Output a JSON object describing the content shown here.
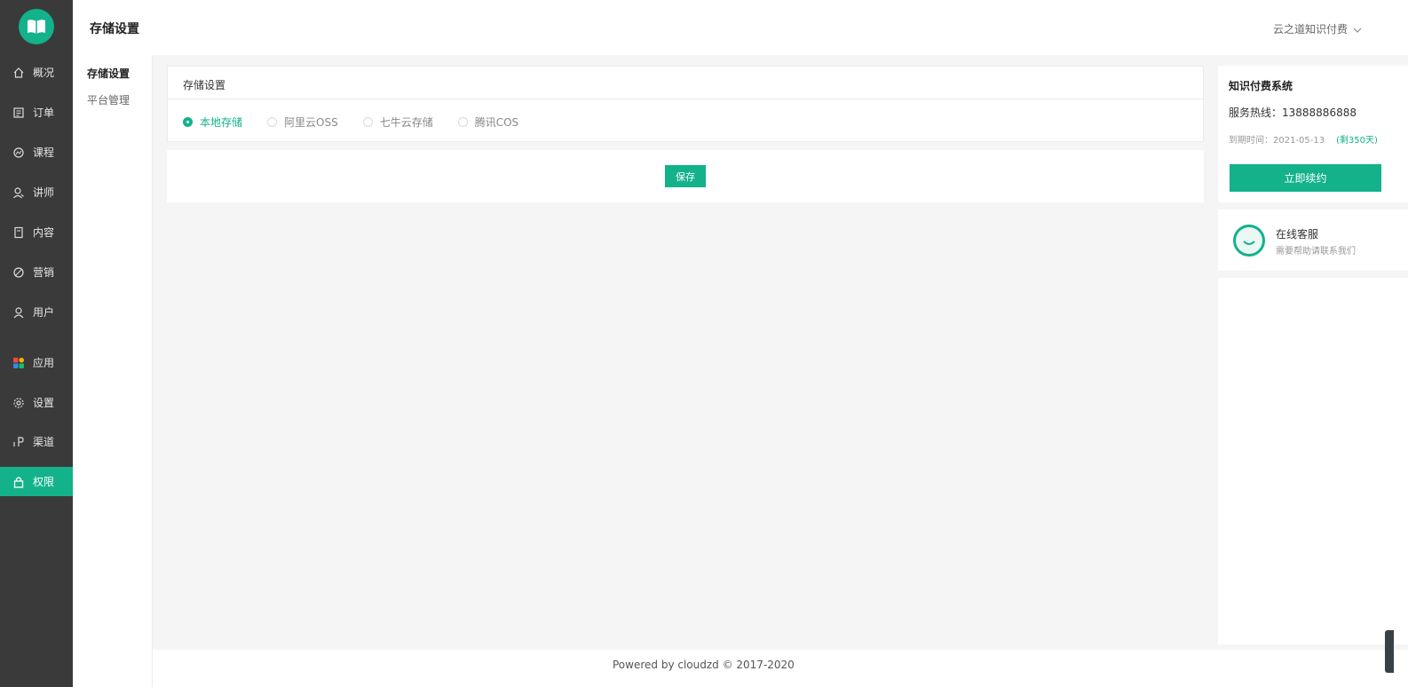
{
  "colors": {
    "accent": "#13b28a",
    "sidebar_bg": "#3a3a3a"
  },
  "nav": {
    "logo_icon": "book-icon",
    "items": [
      {
        "label": "概况",
        "icon": "home-icon"
      },
      {
        "label": "订单",
        "icon": "order-icon"
      },
      {
        "label": "课程",
        "icon": "course-icon"
      },
      {
        "label": "讲师",
        "icon": "lecturer-icon"
      },
      {
        "label": "内容",
        "icon": "content-icon"
      },
      {
        "label": "营销",
        "icon": "marketing-icon"
      },
      {
        "label": "用户",
        "icon": "user-icon"
      },
      {
        "label": "应用",
        "icon": "apps-icon"
      },
      {
        "label": "设置",
        "icon": "gear-icon"
      },
      {
        "label": "渠道",
        "icon": "channel-icon"
      },
      {
        "label": "权限",
        "icon": "lock-icon",
        "active": true
      }
    ]
  },
  "subnav": {
    "items": [
      {
        "label": "存储设置",
        "active": true
      },
      {
        "label": "平台管理"
      }
    ]
  },
  "header": {
    "title": "存储设置",
    "account": "云之道知识付费"
  },
  "storage": {
    "title": "存储设置",
    "options": [
      {
        "label": "本地存储",
        "checked": true
      },
      {
        "label": "阿里云OSS"
      },
      {
        "label": "七牛云存储"
      },
      {
        "label": "腾讯COS"
      }
    ],
    "save_label": "保存"
  },
  "side": {
    "system_title": "知识付费系统",
    "hotline": "服务热线：13888886888",
    "expire": "到期时间：2021-05-13",
    "remaining": "(剩350天)",
    "renew_label": "立即续约",
    "cs_title": "在线客服",
    "cs_sub": "需要帮助请联系我们"
  },
  "footer": {
    "text": "Powered by cloudzd © 2017-2020"
  }
}
